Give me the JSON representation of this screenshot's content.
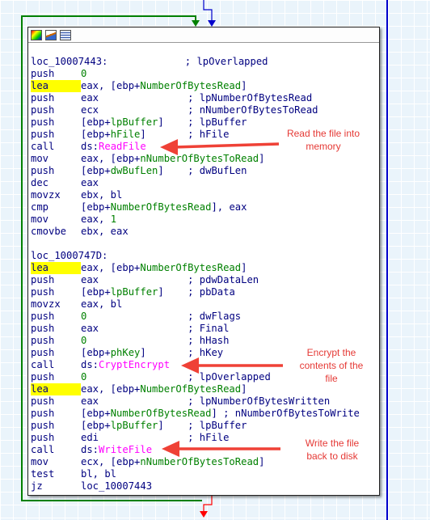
{
  "colors": {
    "address_blue": "#000080",
    "operand_green": "#008000",
    "api_magenta": "#ff00ff",
    "highlight_yellow": "#ffff00",
    "edge_green": "#008000",
    "edge_blue": "#0000cc",
    "edge_red": "#ff0000",
    "annotation_red": "#e53935"
  },
  "toolbar": {
    "icons": [
      "color-palette-icon",
      "rename-icon",
      "graph-overview-icon"
    ]
  },
  "blocks": [
    {
      "label": "loc_10007443:",
      "label_comment": "; lpOverlapped",
      "lines": [
        {
          "mn": "push",
          "ops": [
            {
              "t": "num",
              "v": "0"
            }
          ],
          "cmt": ""
        },
        {
          "mn": "lea",
          "hl": true,
          "ops": [
            {
              "t": "op",
              "v": "eax, [ebp+"
            },
            {
              "t": "var",
              "v": "NumberOfBytesRead"
            },
            {
              "t": "op",
              "v": "]"
            }
          ],
          "cmt": ""
        },
        {
          "mn": "push",
          "ops": [
            {
              "t": "op",
              "v": "eax"
            }
          ],
          "cmt": "; lpNumberOfBytesRead"
        },
        {
          "mn": "push",
          "ops": [
            {
              "t": "op",
              "v": "ecx"
            }
          ],
          "cmt": "; nNumberOfBytesToRead"
        },
        {
          "mn": "push",
          "ops": [
            {
              "t": "op",
              "v": "[ebp+"
            },
            {
              "t": "var",
              "v": "lpBuffer"
            },
            {
              "t": "op",
              "v": "]"
            }
          ],
          "cmt": "; lpBuffer"
        },
        {
          "mn": "push",
          "ops": [
            {
              "t": "op",
              "v": "[ebp+"
            },
            {
              "t": "var",
              "v": "hFile"
            },
            {
              "t": "op",
              "v": "]"
            }
          ],
          "cmt": "; hFile"
        },
        {
          "mn": "call",
          "ops": [
            {
              "t": "op",
              "v": "ds:"
            },
            {
              "t": "api",
              "v": "ReadFile"
            }
          ],
          "cmt": ""
        },
        {
          "mn": "mov",
          "ops": [
            {
              "t": "op",
              "v": "eax, [ebp+"
            },
            {
              "t": "var",
              "v": "nNumberOfBytesToRead"
            },
            {
              "t": "op",
              "v": "]"
            }
          ],
          "cmt": ""
        },
        {
          "mn": "push",
          "ops": [
            {
              "t": "op",
              "v": "[ebp+"
            },
            {
              "t": "var",
              "v": "dwBufLen"
            },
            {
              "t": "op",
              "v": "]"
            }
          ],
          "cmt": "; dwBufLen"
        },
        {
          "mn": "dec",
          "ops": [
            {
              "t": "op",
              "v": "eax"
            }
          ],
          "cmt": ""
        },
        {
          "mn": "movzx",
          "ops": [
            {
              "t": "op",
              "v": "ebx, bl"
            }
          ],
          "cmt": ""
        },
        {
          "mn": "cmp",
          "ops": [
            {
              "t": "op",
              "v": "[ebp+"
            },
            {
              "t": "var",
              "v": "NumberOfBytesRead"
            },
            {
              "t": "op",
              "v": "], eax"
            }
          ],
          "cmt": ""
        },
        {
          "mn": "mov",
          "ops": [
            {
              "t": "op",
              "v": "eax, "
            },
            {
              "t": "num",
              "v": "1"
            }
          ],
          "cmt": ""
        },
        {
          "mn": "cmovbe",
          "ops": [
            {
              "t": "op",
              "v": "ebx, eax"
            }
          ],
          "cmt": ""
        }
      ]
    },
    {
      "label": "loc_1000747D:",
      "label_comment": "",
      "lines": [
        {
          "mn": "lea",
          "hl": true,
          "ops": [
            {
              "t": "op",
              "v": "eax, [ebp+"
            },
            {
              "t": "var",
              "v": "NumberOfBytesRead"
            },
            {
              "t": "op",
              "v": "]"
            }
          ],
          "cmt": ""
        },
        {
          "mn": "push",
          "ops": [
            {
              "t": "op",
              "v": "eax"
            }
          ],
          "cmt": "; pdwDataLen"
        },
        {
          "mn": "push",
          "ops": [
            {
              "t": "op",
              "v": "[ebp+"
            },
            {
              "t": "var",
              "v": "lpBuffer"
            },
            {
              "t": "op",
              "v": "]"
            }
          ],
          "cmt": "; pbData"
        },
        {
          "mn": "movzx",
          "ops": [
            {
              "t": "op",
              "v": "eax, bl"
            }
          ],
          "cmt": ""
        },
        {
          "mn": "push",
          "ops": [
            {
              "t": "num",
              "v": "0"
            }
          ],
          "cmt": "; dwFlags"
        },
        {
          "mn": "push",
          "ops": [
            {
              "t": "op",
              "v": "eax"
            }
          ],
          "cmt": "; Final"
        },
        {
          "mn": "push",
          "ops": [
            {
              "t": "num",
              "v": "0"
            }
          ],
          "cmt": "; hHash"
        },
        {
          "mn": "push",
          "ops": [
            {
              "t": "op",
              "v": "[ebp+"
            },
            {
              "t": "var",
              "v": "phKey"
            },
            {
              "t": "op",
              "v": "]"
            }
          ],
          "cmt": "; hKey"
        },
        {
          "mn": "call",
          "ops": [
            {
              "t": "op",
              "v": "ds:"
            },
            {
              "t": "api",
              "v": "CryptEncrypt"
            }
          ],
          "cmt": ""
        },
        {
          "mn": "push",
          "ops": [
            {
              "t": "num",
              "v": "0"
            }
          ],
          "cmt": "; lpOverlapped"
        },
        {
          "mn": "lea",
          "hl": true,
          "ops": [
            {
              "t": "op",
              "v": "eax, [ebp+"
            },
            {
              "t": "var",
              "v": "NumberOfBytesRead"
            },
            {
              "t": "op",
              "v": "]"
            }
          ],
          "cmt": ""
        },
        {
          "mn": "push",
          "ops": [
            {
              "t": "op",
              "v": "eax"
            }
          ],
          "cmt": "; lpNumberOfBytesWritten"
        },
        {
          "mn": "push",
          "ops": [
            {
              "t": "op",
              "v": "[ebp+"
            },
            {
              "t": "var",
              "v": "NumberOfBytesRead"
            },
            {
              "t": "op",
              "v": "]"
            }
          ],
          "cmt": "; nNumberOfBytesToWrite"
        },
        {
          "mn": "push",
          "ops": [
            {
              "t": "op",
              "v": "[ebp+"
            },
            {
              "t": "var",
              "v": "lpBuffer"
            },
            {
              "t": "op",
              "v": "]"
            }
          ],
          "cmt": "; lpBuffer"
        },
        {
          "mn": "push",
          "ops": [
            {
              "t": "op",
              "v": "edi"
            }
          ],
          "cmt": "; hFile"
        },
        {
          "mn": "call",
          "ops": [
            {
              "t": "op",
              "v": "ds:"
            },
            {
              "t": "api",
              "v": "WriteFile"
            }
          ],
          "cmt": ""
        },
        {
          "mn": "mov",
          "ops": [
            {
              "t": "op",
              "v": "ecx, [ebp+"
            },
            {
              "t": "var",
              "v": "nNumberOfBytesToRead"
            },
            {
              "t": "op",
              "v": "]"
            }
          ],
          "cmt": ""
        },
        {
          "mn": "test",
          "ops": [
            {
              "t": "op",
              "v": "bl, bl"
            }
          ],
          "cmt": ""
        },
        {
          "mn": "jz",
          "ops": [
            {
              "t": "op",
              "v": "loc_10007443"
            }
          ],
          "cmt": ""
        }
      ]
    }
  ],
  "annotations": {
    "read": [
      "Read the file into",
      "memory"
    ],
    "encrypt": [
      "Encrypt the",
      "contents of the",
      "file"
    ],
    "write": [
      "Write the file",
      "back to disk"
    ]
  }
}
